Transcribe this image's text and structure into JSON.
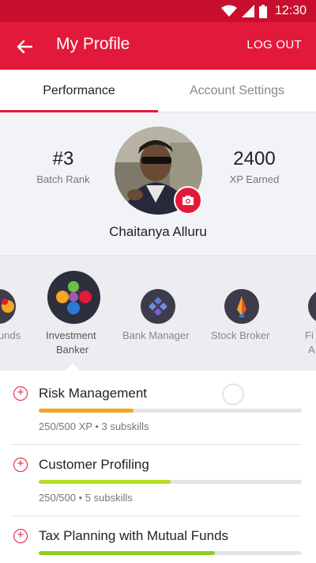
{
  "status_bar": {
    "time": "12:30"
  },
  "app_bar": {
    "title": "My Profile",
    "logout_label": "LOG OUT"
  },
  "tabs": [
    {
      "label": "Performance",
      "active": true
    },
    {
      "label": "Account Settings",
      "active": false
    }
  ],
  "profile": {
    "rank_value": "#3",
    "rank_label": "Batch Rank",
    "xp_value": "2400",
    "xp_label": "XP Earned",
    "name": "Chaitanya Alluru"
  },
  "careers": [
    {
      "line1": "unds",
      "line2": "",
      "icon": "funds-icon",
      "selected": false
    },
    {
      "line1": "Investment",
      "line2": "Banker",
      "icon": "investment-banker-icon",
      "selected": true
    },
    {
      "line1": "Bank Manager",
      "line2": "",
      "icon": "bank-manager-icon",
      "selected": false
    },
    {
      "line1": "Stock Broker",
      "line2": "",
      "icon": "stock-broker-icon",
      "selected": false
    },
    {
      "line1": "Fi",
      "line2": "A",
      "icon": "financial-advisor-icon",
      "selected": false
    }
  ],
  "skills": [
    {
      "name": "Risk Management",
      "meta": "250/500 XP • 3 subskills",
      "progress": 0.36,
      "color": "#f5a623"
    },
    {
      "name": "Customer Profiling",
      "meta": "250/500 • 5 subskills",
      "progress": 0.5,
      "color": "#b6dd25"
    },
    {
      "name": "Tax Planning with Mutual Funds",
      "meta": "",
      "progress": 0.67,
      "color": "#8fcf1c"
    }
  ],
  "colors": {
    "accent": "#e3193b",
    "status_bar": "#c8102e"
  }
}
